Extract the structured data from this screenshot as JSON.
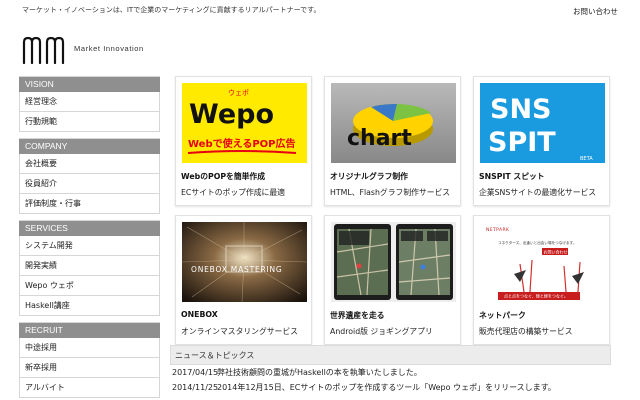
{
  "header": {
    "tagline": "マーケット・イノベーションは、ITで企業のマーケティングに貢献するリアルパートナーです。",
    "contact_link": "お問い合わせ",
    "logo_text": "Market Innovation"
  },
  "sidebar": {
    "groups": [
      {
        "title": "VISION",
        "items": [
          "経営理念",
          "行動規範"
        ]
      },
      {
        "title": "COMPANY",
        "items": [
          "会社概要",
          "役員紹介",
          "評価制度・行事"
        ]
      },
      {
        "title": "SERVICES",
        "items": [
          "システム開発",
          "開発実績",
          "Wepo ウェポ",
          "Haskell講座"
        ]
      },
      {
        "title": "RECRUIT",
        "items": [
          "中途採用",
          "新卒採用",
          "アルバイト"
        ]
      }
    ]
  },
  "tiles": [
    {
      "title": "WebのPOPを簡単作成",
      "desc": "ECサイトのポップ作成に最適",
      "img": {
        "ruby": "ウェポ",
        "big": "Wepo",
        "sub": "Webで使えるPOP広告"
      }
    },
    {
      "title": "オリジナルグラフ制作",
      "desc": "HTML、Flashグラフ制作サービス",
      "img": {
        "word": "chart"
      }
    },
    {
      "title": "SNSPIT スピット",
      "desc": "企業SNSサイトの最適化サービス",
      "img": {
        "line1": "SNS",
        "line2": "SPIT",
        "badge": "BETA"
      }
    },
    {
      "title": "ONEBOX",
      "desc": "オンラインマスタリングサービス",
      "img": {
        "word": "ONEBOX MASTERING"
      }
    },
    {
      "title": "世界遺産を走る",
      "desc": "Android版 ジョギングアプリ",
      "img": {}
    },
    {
      "title": "ネットパーク",
      "desc": "販売代理店の構築サービス",
      "img": {
        "brand": "NETPARK",
        "headline": "コネクターズ、出逢いと出会い場をつなげます。",
        "button": "お問い合わせ",
        "tagline": "点と点をつなぐ、線と線をつなぐ。"
      }
    }
  ],
  "news": {
    "heading": "ニュース＆トピックス",
    "items": [
      {
        "date": "2017/04/15",
        "text": "弊社技術顧問の重城がHaskellの本を執筆いたしました。"
      },
      {
        "date": "2014/11/25",
        "text": "2014年12月15日、ECサイトのポップを作成するツール「Wepo ウェポ」をリリースします。"
      }
    ]
  },
  "colors": {
    "nav_header": "#8f8f8f",
    "wepo_yellow": "#ffea00",
    "wepo_red": "#e60012",
    "snspit_blue": "#1a9be0",
    "chart_yellow": "#ffd200"
  }
}
